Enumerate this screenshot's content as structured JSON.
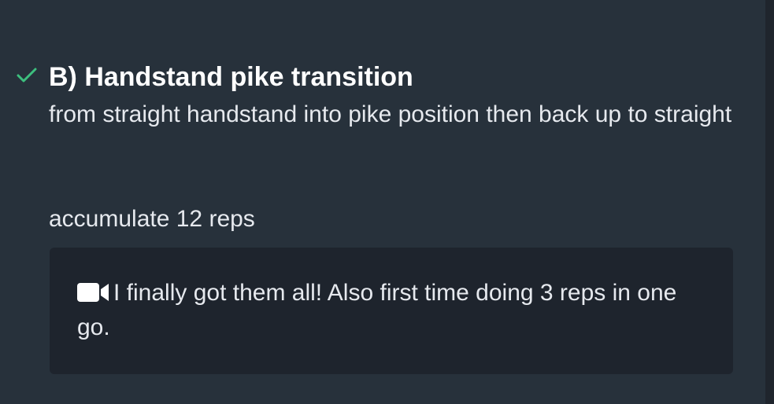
{
  "exercise": {
    "title": "B) Handstand pike transition",
    "description": "from straight handstand into pike position then back up to straight",
    "target": "accumulate 12 reps",
    "completed": true,
    "check_color": "#3dbf7e"
  },
  "note": {
    "icon": "video-camera-icon",
    "text": "I finally got them all! Also first time doing 3 reps in one go."
  }
}
